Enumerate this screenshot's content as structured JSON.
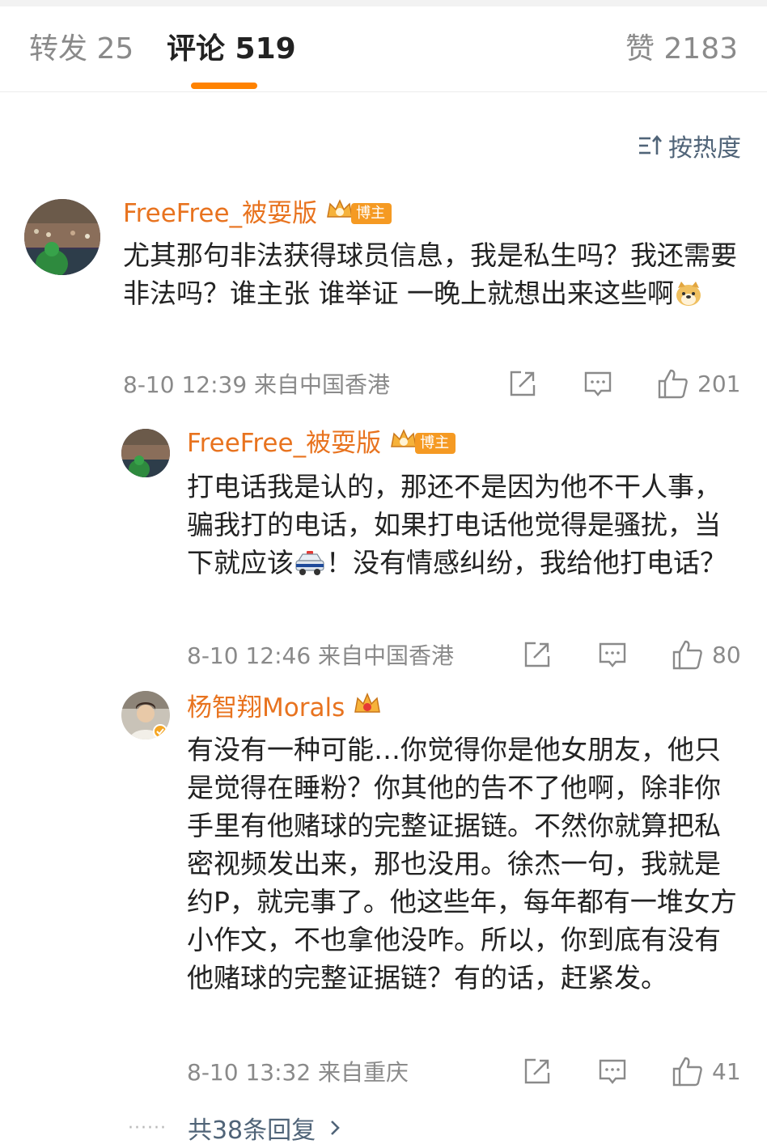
{
  "tabs": {
    "repost": "转发 25",
    "comment": "评论 519",
    "like": "赞 2183"
  },
  "sort": {
    "label": "按热度",
    "icon": "sort-icon"
  },
  "colors": {
    "accent": "#ff8200",
    "username": "#e8731f",
    "link": "#506478",
    "muted": "#8a8a8a"
  },
  "comments": [
    {
      "user": "FreeFree_被耍版",
      "badge": "博主",
      "text": "尤其那句非法获得球员信息，我是私生吗？我还需要非法吗？谁主张 谁举证 一晚上就想出来这些啊",
      "emoji": "doge-emoji",
      "meta": "8-10 12:39  来自中国香港",
      "likes": "201"
    },
    {
      "user": "FreeFree_被耍版",
      "badge": "博主",
      "text_a": "打电话我是认的，那还不是因为他不干人事，骗我打的电话，如果打电话他觉得是骚扰，当下就应该",
      "emoji": "police-car-emoji",
      "text_b": "！没有情感纠纷，我给他打电话？",
      "meta": "8-10 12:46  来自中国香港",
      "likes": "80"
    },
    {
      "user": "杨智翔Morals",
      "text": "有没有一种可能…你觉得你是他女朋友，他只是觉得在睡粉？你其他的告不了他啊，除非你手里有他赌球的完整证据链。不然你就算把私密视频发出来，那也没用。徐杰一句，我就是约P，就完事了。他这些年，每年都有一堆女方小作文，不也拿他没咋。所以，你到底有没有他赌球的完整证据链？有的话，赶紧发。",
      "meta": "8-10 13:32  来自重庆",
      "likes": "41"
    }
  ],
  "more_replies": "共38条回复"
}
